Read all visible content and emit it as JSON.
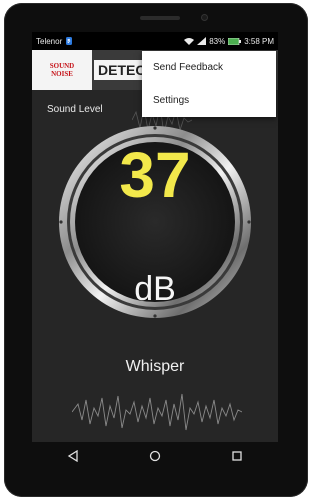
{
  "status": {
    "carrier": "Telenor",
    "battery": "83%",
    "time": "3:58 PM"
  },
  "app": {
    "logo_line1": "SOUND",
    "logo_line2": "NOISE",
    "title": "DETECTOR"
  },
  "menu": {
    "items": [
      "Send Feedback",
      "Settings"
    ]
  },
  "meter": {
    "label": "Sound Level",
    "value": "37",
    "unit": "dB",
    "description": "Whisper"
  },
  "colors": {
    "value": "#f2e84b",
    "logo_red": "#c6151b"
  },
  "icons": {
    "nav": [
      "back-icon",
      "home-icon",
      "recents-icon"
    ]
  }
}
